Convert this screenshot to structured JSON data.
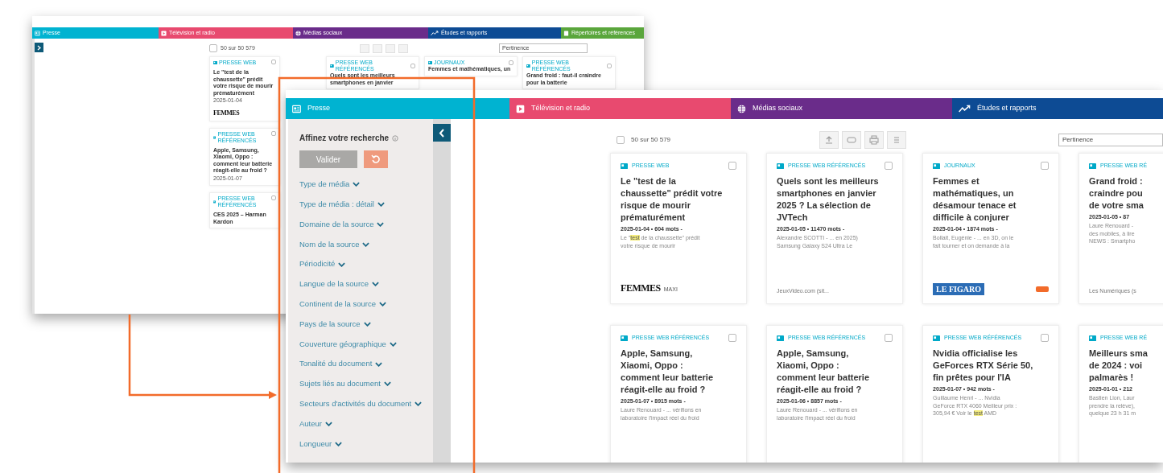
{
  "back_window": {
    "tabs": [
      {
        "label": "Presse",
        "color": "#00b3d1"
      },
      {
        "label": "Télévision et radio",
        "color": "#e84a6f"
      },
      {
        "label": "Médias sociaux",
        "color": "#6a2c8a"
      },
      {
        "label": "Études et rapports",
        "color": "#0d4b94"
      },
      {
        "label": "Répertoires et références",
        "color": "#5aa63c"
      }
    ],
    "select_all_checked": false,
    "result_count": "50 sur 50 579",
    "sort": "Pertinence",
    "side_cards": [
      {
        "label": "PRESSE WEB",
        "checked": false,
        "title": "Le \"test de la chaussette\" prédit votre risque de mourir prématurément",
        "meta": "2025-01-04",
        "logo": "FEMMES"
      },
      {
        "label": "PRESSE WEB RÉFÉRENCÉS",
        "checked": false,
        "title": "Apple, Samsung, Xiaomi, Oppo : comment leur batterie réagit-elle au froid ?",
        "meta": "2025-01-07"
      },
      {
        "label": "PRESSE WEB RÉFÉRENCÉS",
        "checked": false,
        "title": "CES 2025 – Harman Kardon"
      }
    ],
    "top_cards": [
      {
        "label": "PRESSE WEB RÉFÉRENCÉS",
        "checked": false,
        "title": "Quels sont les meilleurs smartphones en janvier"
      },
      {
        "label": "JOURNAUX",
        "checked": false,
        "title": "Femmes et mathématiques, un"
      },
      {
        "label": "PRESSE WEB RÉFÉRENCÉS",
        "checked": false,
        "title": "Grand froid : faut-il craindre pour la batterie"
      }
    ]
  },
  "front_window": {
    "tabs": [
      {
        "label": "Presse",
        "color": "#00b3d1"
      },
      {
        "label": "Télévision et radio",
        "color": "#e84a6f"
      },
      {
        "label": "Médias sociaux",
        "color": "#6a2c8a"
      },
      {
        "label": "Études et rapports",
        "color": "#0d4b94"
      }
    ],
    "filter_panel": {
      "title": "Affinez votre recherche",
      "validate_button": "Valider",
      "filters": [
        "Type de média",
        "Type de média : détail",
        "Domaine de la source",
        "Nom de la source",
        "Périodicité",
        "Langue de la source",
        "Continent de la source",
        "Pays de la source",
        "Couverture géographique",
        "Tonalité du document",
        "Sujets liés au document",
        "Secteurs d'activités du document",
        "Auteur",
        "Longueur"
      ]
    },
    "select_all_checked": false,
    "result_count": "50 sur 50 579",
    "sort": "Pertinence",
    "cards": [
      {
        "label": "PRESSE WEB",
        "checked": false,
        "title_lines": [
          "Le \"test de la",
          "chaussette\" prédit votre",
          "risque de mourir",
          "prématurément"
        ],
        "meta": "2025-01-04 • 604 mots -",
        "snippet_lines": [
          "Le \"**test** de la chaussette\" prédit",
          "votre risque de mourir"
        ],
        "footer": {
          "kind": "serif",
          "text": "FEMMES",
          "sub": "MAXI"
        }
      },
      {
        "label": "PRESSE WEB RÉFÉRENCÉS",
        "checked": false,
        "title_lines": [
          "Quels sont les meilleurs",
          "smartphones en janvier",
          "2025 ? La sélection de",
          "JVTech"
        ],
        "meta": "2025-01-05 • 11470 mots -",
        "snippet_lines": [
          "Alexandre SCOTTI - ... en 2025)",
          "Samsung Galaxy S24 Ultra Le"
        ],
        "footer": {
          "kind": "text",
          "text": "JeuxVideo.com (sit..."
        }
      },
      {
        "label": "JOURNAUX",
        "checked": false,
        "title_lines": [
          "Femmes et",
          "mathématiques, un",
          "désamour tenace et",
          "difficile à conjurer"
        ],
        "meta": "2025-01-04 • 1874 mots -",
        "snippet_lines": [
          "Bollait, Eugénie - ... en 3D, on le",
          "fait tourner et on demande à la"
        ],
        "footer": {
          "kind": "boxed",
          "text": "LE FIGARO"
        }
      },
      {
        "label": "PRESSE WEB RÉ",
        "title_lines": [
          "Grand froid :",
          "craindre pou",
          "de votre sma"
        ],
        "meta": "2025-01-05 • 87",
        "snippet_lines": [
          "Laure Renouard -",
          "des mobiles, à lire",
          "NEWS : Smartpho"
        ],
        "footer": {
          "kind": "text",
          "text": "Les Numériques (s"
        }
      },
      {
        "label": "PRESSE WEB RÉFÉRENCÉS",
        "checked": false,
        "title_lines": [
          "Apple, Samsung,",
          "Xiaomi, Oppo :",
          "comment leur batterie",
          "réagit-elle au froid ?"
        ],
        "meta": "2025-01-07 • 8915 mots -",
        "snippet_lines": [
          "Laure Renouard - ... vérifions en",
          "laboratoire l'impact réel du froid"
        ]
      },
      {
        "label": "PRESSE WEB RÉFÉRENCÉS",
        "checked": false,
        "title_lines": [
          "Apple, Samsung,",
          "Xiaomi, Oppo :",
          "comment leur batterie",
          "réagit-elle au froid ?"
        ],
        "meta": "2025-01-06 • 8857 mots -",
        "snippet_lines": [
          "Laure Renouard - ... vérifions en",
          "laboratoire l'impact réel du froid"
        ]
      },
      {
        "label": "PRESSE WEB RÉFÉRENCÉS",
        "checked": false,
        "title_lines": [
          "Nvidia officialise les",
          "GeForces RTX Série 50,",
          "fin prêtes pour l'IA"
        ],
        "meta": "2025-01-07 • 942 mots -",
        "snippet_lines": [
          "Guillaume Henri - ... Nvidia",
          "GeForce RTX 4060 Meilleur prix :",
          "305,94 € Voir le **test** AMD"
        ]
      },
      {
        "label": "PRESSE WEB RÉ",
        "title_lines": [
          "Meilleurs sma",
          "de 2024 : voi",
          "palmarès !"
        ],
        "meta": "2025-01-01 • 212",
        "snippet_lines": [
          "Bastien Lion, Laur",
          "prendre la relève),",
          "quelque 23 h 31 m"
        ]
      }
    ]
  }
}
